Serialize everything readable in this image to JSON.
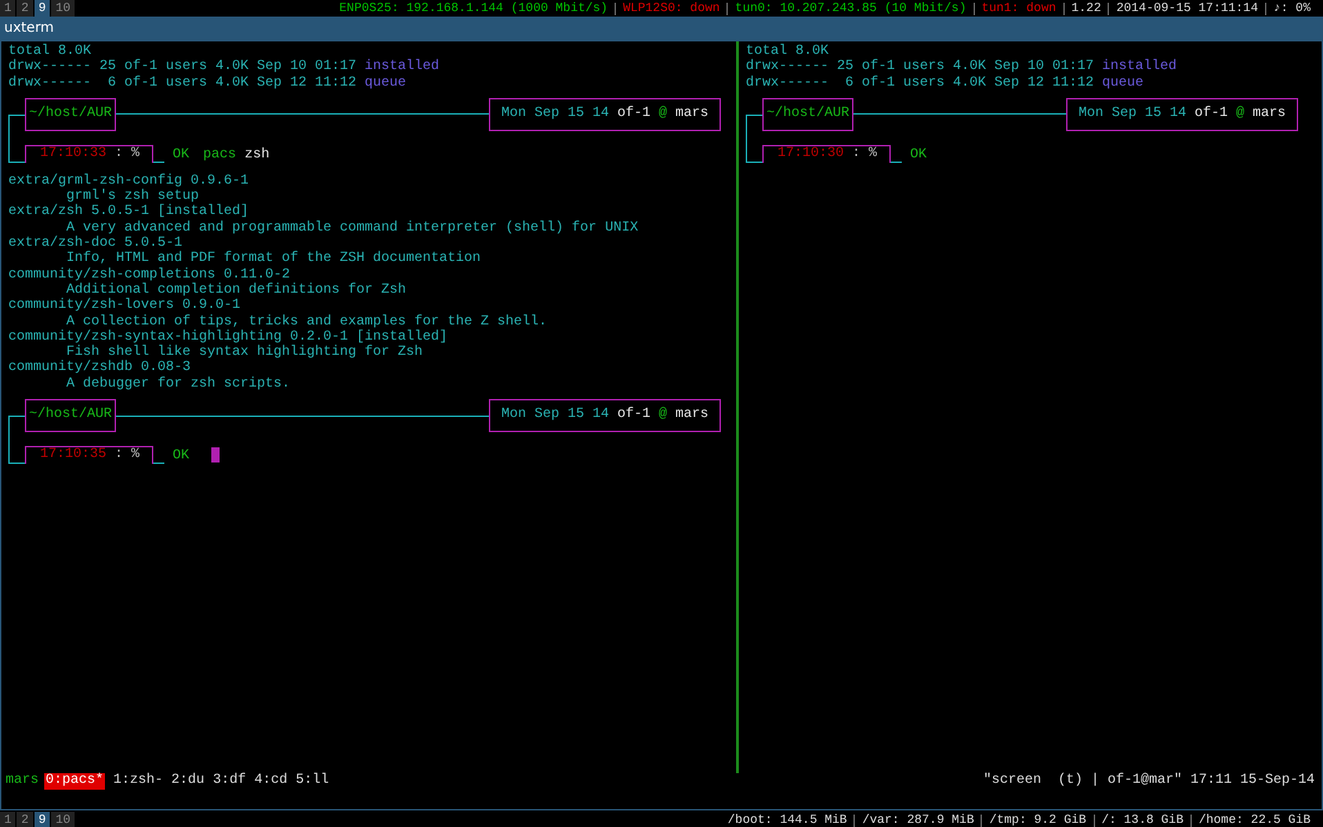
{
  "top_bar": {
    "workspaces": [
      {
        "label": "1",
        "selected": false
      },
      {
        "label": "2",
        "selected": false
      },
      {
        "label": "9",
        "selected": true
      },
      {
        "label": "10",
        "selected": false
      }
    ],
    "status": [
      {
        "text": "ENP0S25: 192.168.1.144 (1000 Mbit/s)",
        "kind": "up"
      },
      {
        "text": "WLP12S0: down",
        "kind": "down"
      },
      {
        "text": "tun0: 10.207.243.85 (10 Mbit/s)",
        "kind": "up"
      },
      {
        "text": "tun1: down",
        "kind": "down"
      },
      {
        "text": "1.22",
        "kind": "info"
      },
      {
        "text": "2014-09-15 17:11:14",
        "kind": "info"
      },
      {
        "text": "♪: 0%",
        "kind": "info"
      }
    ]
  },
  "window": {
    "title": "uxterm"
  },
  "panes": [
    {
      "blocks": [
        {
          "kind": "listing",
          "lines": [
            {
              "text": "total 8.0K"
            },
            {
              "text": "drwx------ 25 of-1 users 4.0K Sep 10 01:17",
              "name": "installed"
            },
            {
              "text": "drwx------  6 of-1 users 4.0K Sep 12 11:12",
              "name": "queue"
            }
          ]
        },
        {
          "kind": "prompt",
          "path": "~/host/AUR",
          "date": "Mon Sep 15 14",
          "user": "of-1",
          "at": "@",
          "host": "mars",
          "time": "17:10:33",
          "symbol": ": %",
          "status": "OK",
          "command": "pacs",
          "args": "zsh",
          "cursor": false
        },
        {
          "kind": "packages",
          "lines": [
            {
              "kind": "package",
              "text": "extra/grml-zsh-config 0.9.6-1"
            },
            {
              "kind": "description",
              "text": "grml's zsh setup"
            },
            {
              "kind": "package",
              "text": "extra/zsh 5.0.5-1 [installed]"
            },
            {
              "kind": "description",
              "text": "A very advanced and programmable command interpreter (shell) for UNIX"
            },
            {
              "kind": "package",
              "text": "extra/zsh-doc 5.0.5-1"
            },
            {
              "kind": "description",
              "text": "Info, HTML and PDF format of the ZSH documentation"
            },
            {
              "kind": "package",
              "text": "community/zsh-completions 0.11.0-2"
            },
            {
              "kind": "description",
              "text": "Additional completion definitions for Zsh"
            },
            {
              "kind": "package",
              "text": "community/zsh-lovers 0.9.0-1"
            },
            {
              "kind": "description",
              "text": "A collection of tips, tricks and examples for the Z shell."
            },
            {
              "kind": "package",
              "text": "community/zsh-syntax-highlighting 0.2.0-1 [installed]"
            },
            {
              "kind": "description",
              "text": "Fish shell like syntax highlighting for Zsh"
            },
            {
              "kind": "package",
              "text": "community/zshdb 0.08-3"
            },
            {
              "kind": "description",
              "text": "A debugger for zsh scripts."
            }
          ]
        },
        {
          "kind": "prompt",
          "path": "~/host/AUR",
          "date": "Mon Sep 15 14",
          "user": "of-1",
          "at": "@",
          "host": "mars",
          "time": "17:10:35",
          "symbol": ": %",
          "status": "OK",
          "cursor": true
        }
      ]
    },
    {
      "blocks": [
        {
          "kind": "listing",
          "lines": [
            {
              "text": "total 8.0K"
            },
            {
              "text": "drwx------ 25 of-1 users 4.0K Sep 10 01:17",
              "name": "installed"
            },
            {
              "text": "drwx------  6 of-1 users 4.0K Sep 12 11:12",
              "name": "queue"
            }
          ]
        },
        {
          "kind": "prompt",
          "path": "~/host/AUR",
          "date": "Mon Sep 15 14",
          "user": "of-1",
          "at": "@",
          "host": "mars",
          "time": "17:10:30",
          "symbol": ": %",
          "status": "OK",
          "cursor": false
        }
      ]
    }
  ],
  "tmux_status": {
    "session": "mars",
    "windows": [
      {
        "label": "0:pacs*",
        "selected": true
      },
      {
        "label": "1:zsh-",
        "selected": false
      },
      {
        "label": "2:du",
        "selected": false
      },
      {
        "label": "3:df",
        "selected": false
      },
      {
        "label": "4:cd",
        "selected": false
      },
      {
        "label": "5:ll",
        "selected": false
      }
    ],
    "right": "\"screen  (t) | of-1@mar\" 17:11 15-Sep-14"
  },
  "bottom_bar": {
    "workspaces": [
      {
        "label": "1",
        "selected": false
      },
      {
        "label": "2",
        "selected": false
      },
      {
        "label": "9",
        "selected": true
      },
      {
        "label": "10",
        "selected": false
      }
    ],
    "disks": [
      "/boot: 144.5 MiB",
      "/var: 287.9 MiB",
      "/tmp: 9.2 GiB",
      "/: 13.8 GiB",
      "/home: 22.5 GiB"
    ]
  }
}
